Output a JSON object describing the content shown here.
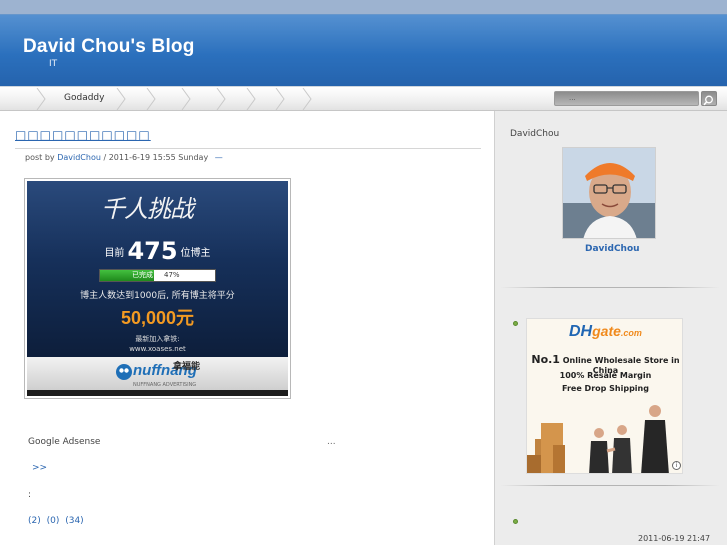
{
  "header": {
    "title": "David Chou's Blog",
    "subtitle": "IT"
  },
  "nav": {
    "items": [
      {
        "label": ""
      },
      {
        "label": ""
      },
      {
        "label": "Godaddy"
      },
      {
        "label": ""
      },
      {
        "label": ""
      },
      {
        "label": ""
      },
      {
        "label": ""
      },
      {
        "label": ""
      },
      {
        "label": ""
      }
    ],
    "search": {
      "placeholder": "...",
      "icon": "search-icon"
    }
  },
  "post": {
    "title": "□□□□□□□□□□□",
    "meta_prefix": "post by",
    "author": "DavidChou",
    "meta_sep": "/",
    "date": "2011-6-19 15:55 Sunday",
    "dash": "—",
    "banner": {
      "headline": "千人挑战",
      "count_prefix": "目前",
      "count": "475",
      "count_suffix": "位博主",
      "progress_label": "已完成",
      "progress_value": 0.47,
      "progress_text": "47%",
      "line1": "博主人数达到1000后, 所有博主将平分",
      "prize": "50,000元",
      "line2": "最新加入拿铁:",
      "url": "www.xoases.net",
      "logo_text": "nuffnang",
      "logo_cn": "拿福能",
      "logo_tag": "NUFFNANG ADVERTISING"
    },
    "adsense": "Google Adsense",
    "ellipsis": "...",
    "more": ">>",
    "colon": ":",
    "stats": "(2)  (0)  (34)"
  },
  "sidebar": {
    "heading": "DavidChou",
    "avatar_name": "DavidChou",
    "ad": {
      "logo": "DH",
      "logo_accent": "gate",
      "logo_cn": ".com",
      "line1_no": "No.1",
      "line1": " Online Wholesale Store in China",
      "line2": "100% Resale Margin",
      "line3": "Free Drop Shipping",
      "info": "i"
    },
    "date": "2011-06-19 21:47"
  },
  "colors": {
    "header_blue": "#2b70bd",
    "link_blue": "#2b66b0",
    "bullet_green": "#7cae46",
    "prize_orange": "#f39a22"
  }
}
